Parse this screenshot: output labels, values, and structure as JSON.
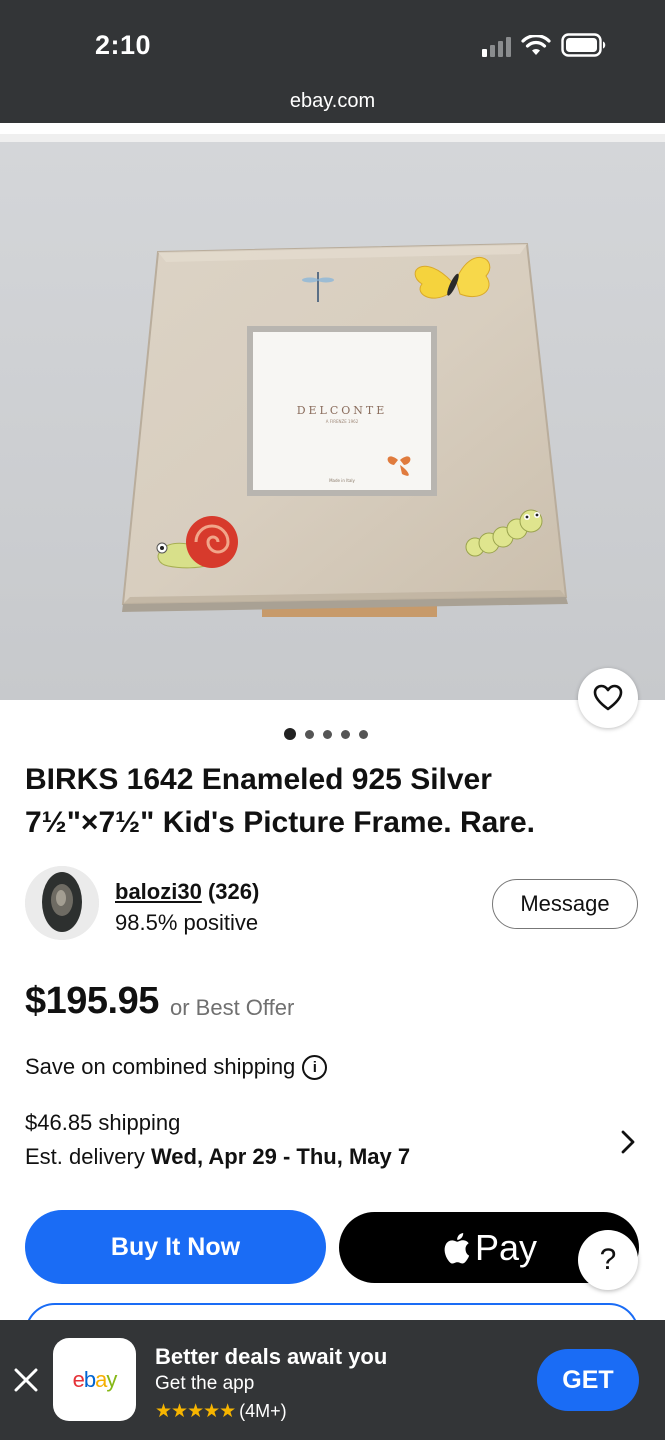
{
  "status_bar": {
    "time": "2:10"
  },
  "browser": {
    "url": "ebay.com"
  },
  "gallery": {
    "image_alt": "Silver enameled picture frame",
    "frame_brand_text": "DELCONTE",
    "frame_sub_text": "A FIRENZE 1962",
    "frame_made_in": "Made in Italy",
    "dot_count": 5,
    "active_dot": 0
  },
  "listing": {
    "title": "BIRKS 1642 Enameled 925 Silver 7½\"×7½\" Kid's Picture Frame. Rare."
  },
  "seller": {
    "username": "balozi30",
    "score": "(326)",
    "feedback": "98.5% positive",
    "message_label": "Message"
  },
  "pricing": {
    "price": "$195.95",
    "offer_text": "or Best Offer",
    "combined_shipping": "Save on combined shipping",
    "shipping": "$46.85 shipping",
    "delivery_prefix": "Est. delivery ",
    "delivery_dates": "Wed, Apr 29 - Thu, May 7"
  },
  "actions": {
    "buy_now": "Buy It Now",
    "apple_pay": "Pay",
    "help": "?"
  },
  "app_banner": {
    "title": "Better deals await you",
    "subtitle": "Get the app",
    "stars": "★★★★★",
    "rating_count": "(4M+)",
    "get_label": "GET",
    "logo_e": "e",
    "logo_b": "b",
    "logo_a": "a",
    "logo_y": "y"
  },
  "colors": {
    "accent_blue": "#1a6cf5",
    "dark_bar": "#333537",
    "star_gold": "#f7b500"
  }
}
